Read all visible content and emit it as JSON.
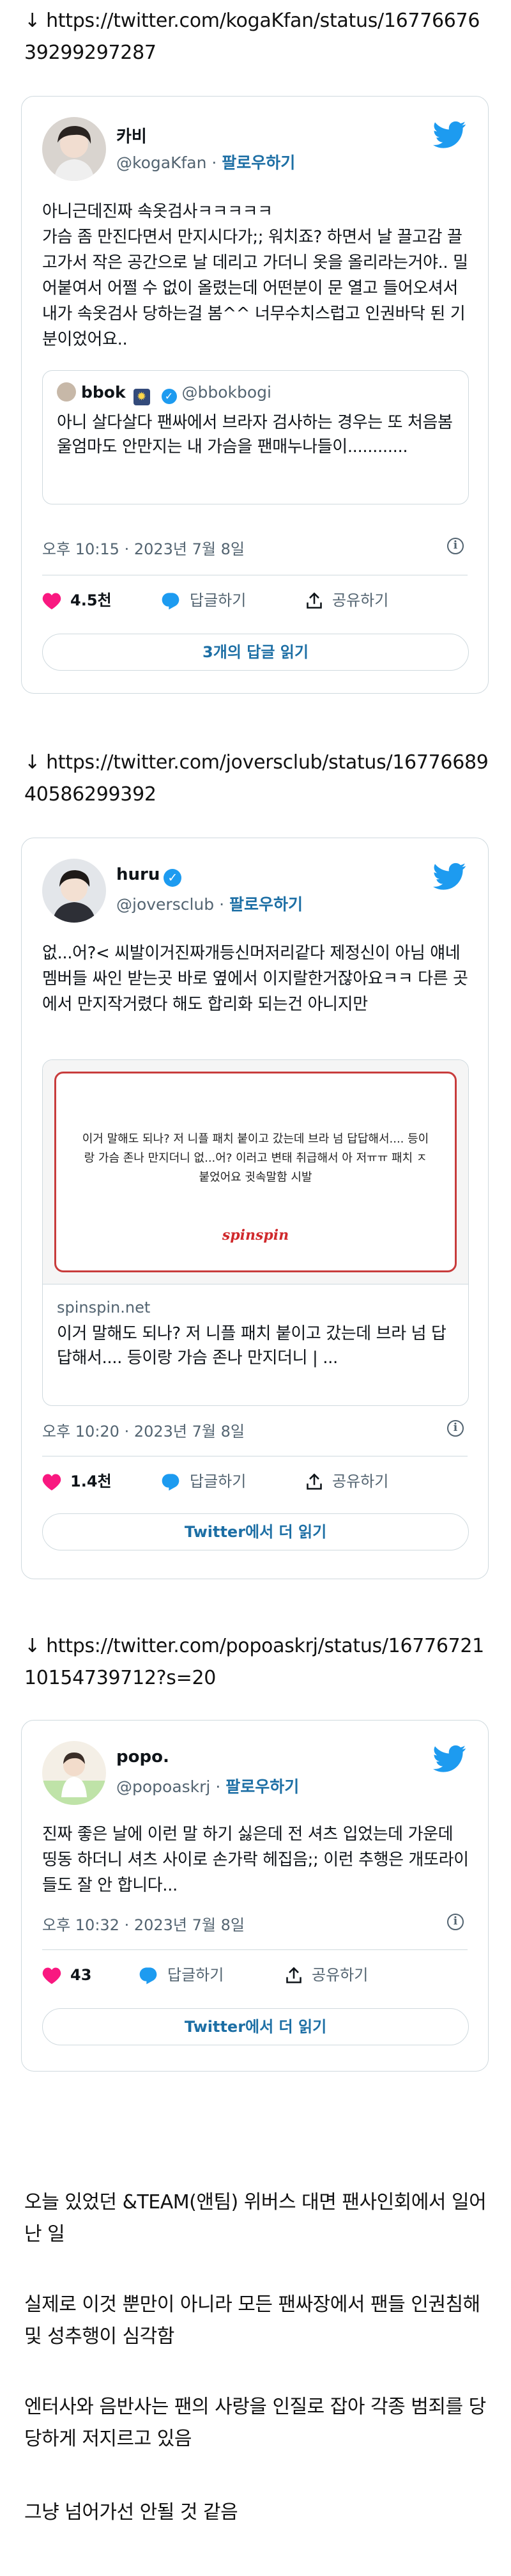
{
  "posts": [
    {
      "url": "↓ https://twitter.com/kogaKfan/status/1677667639299297287",
      "name": "카비",
      "handle": "@kogaKfan",
      "follow": "팔로우하기",
      "text": "아니근데진짜 속옷검사ㅋㅋㅋㅋㅋ\n가슴 좀 만진다면서 만지시다가;; 워치죠? 하면서 날 끌고감 끌고가서 작은 공간으로 날 데리고 가더니 옷을 올리라는거야.. 밀어붙여서 어쩔 수 없이 올렸는데 어떤분이 문 열고 들어오셔서 내가 속옷검사 당하는걸 봄^^ 너무수치스럽고 인권바닥 된 기분이었어요..",
      "quote_name": "bbok",
      "quote_handle": "@bbokbogi",
      "quote_text": "아니 살다살다 팬싸에서 브라자 검사하는 경우는 또 처음봄 울엄마도 안만지는 내 가슴을 팬매누나들이............",
      "time": "오후 10:15 · 2023년 7월 8일",
      "likes": "4.5천",
      "reply": "답글하기",
      "share": "공유하기",
      "button": "3개의 답글 읽기"
    },
    {
      "url": "↓ https://twitter.com/joversclub/status/1677668940586299392",
      "name": "huru",
      "handle": "@joversclub",
      "follow": "팔로우하기",
      "text": "없...어?< 씨발이거진짜개등신머저리같다 제정신이 아님 얘네 멤버들 싸인 받는곳 바로 옆에서 이지랄한거잖아요ㅋㅋ 다른 곳에서 만지작거렸다 해도 합리화 되는건 아니지만",
      "link_image_text": "이거 말해도 되나? 저 니플 패치 붙이고 갔는데 브라 넘 답답해서.... 등이랑 가슴 존나 만지더니 없...어? 이러고 변태 취급해서 아 저ㅠㅠ 패치 ㅈ붙었어요 귓속말함 시발",
      "link_logo": "spinspin",
      "link_domain": "spinspin.net",
      "link_title": "이거 말해도 되나? 저 니플 패치 붙이고 갔는데 브라 넘 답답해서.... 등이랑 가슴 존나 만지더니 | ...",
      "time": "오후 10:20 · 2023년 7월 8일",
      "likes": "1.4천",
      "reply": "답글하기",
      "share": "공유하기",
      "button": "Twitter에서 더 읽기"
    },
    {
      "url": "↓ https://twitter.com/popoaskrj/status/1677672110154739712?s=20",
      "name": "popo.",
      "handle": "@popoaskrj",
      "follow": "팔로우하기",
      "text": "진짜 좋은 날에 이런 말 하기 싫은데 전 셔츠 입었는데 가운데 띵동 하더니 셔츠 사이로 손가락 헤집음;; 이런 추행은 개또라이들도 잘 안 합니다...",
      "time": "오후 10:32 · 2023년 7월 8일",
      "likes": "43",
      "reply": "답글하기",
      "share": "공유하기",
      "button": "Twitter에서 더 읽기"
    }
  ],
  "paragraphs": [
    "오늘 있었던 &TEAM(앤팀) 위버스 대면 팬사인회에서 일어난 일",
    "실제로 이것 뿐만이 아니라 모든 팬싸장에서 팬들 인권침해 및 성추행이 심각함",
    "엔터사와 음반사는 팬의 사랑을 인질로 잡아 각종 범죄를 당당하게 저지르고 있음",
    "그냥 넘어가선 안될 것 같음"
  ],
  "colors": {
    "twitter_blue": "#1d9bf0",
    "heart": "#f91880",
    "link": "#1d6fa5"
  }
}
